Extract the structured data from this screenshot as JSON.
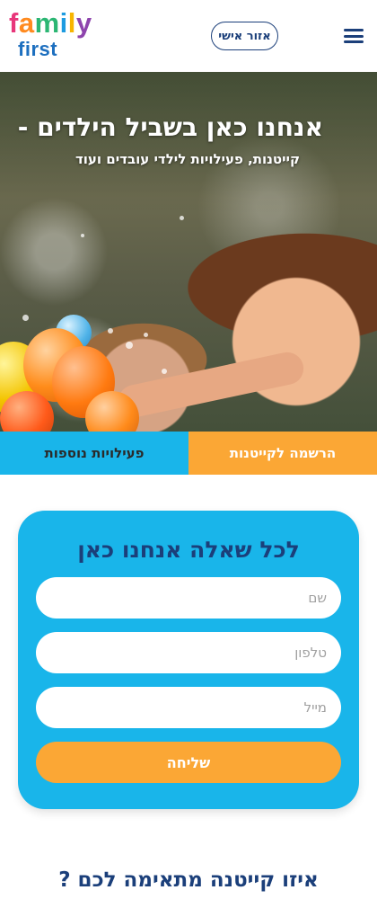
{
  "header": {
    "logo_top": [
      "f",
      "a",
      "m",
      "i",
      "l",
      "y"
    ],
    "logo_bottom": "first",
    "personal_area_label": "אזור אישי",
    "menu_icon": "hamburger-icon"
  },
  "hero": {
    "title": "אנחנו כאן בשביל הילדים -",
    "subtitle": "קייטנות, פעילויות לילדי עובדים ועוד"
  },
  "tabs": {
    "register": "הרשמה לקייטנות",
    "more_activities": "פעילויות נוספות"
  },
  "contact_form": {
    "title": "לכל שאלה אנחנו כאן",
    "name_placeholder": "שם",
    "phone_placeholder": "טלפון",
    "email_placeholder": "מייל",
    "submit_label": "שליחה"
  },
  "section": {
    "title": "איזו קייטנה מתאימה לכם ?"
  },
  "colors": {
    "navy": "#1b3f7a",
    "sky": "#19b5ea",
    "orange": "#fba735"
  }
}
